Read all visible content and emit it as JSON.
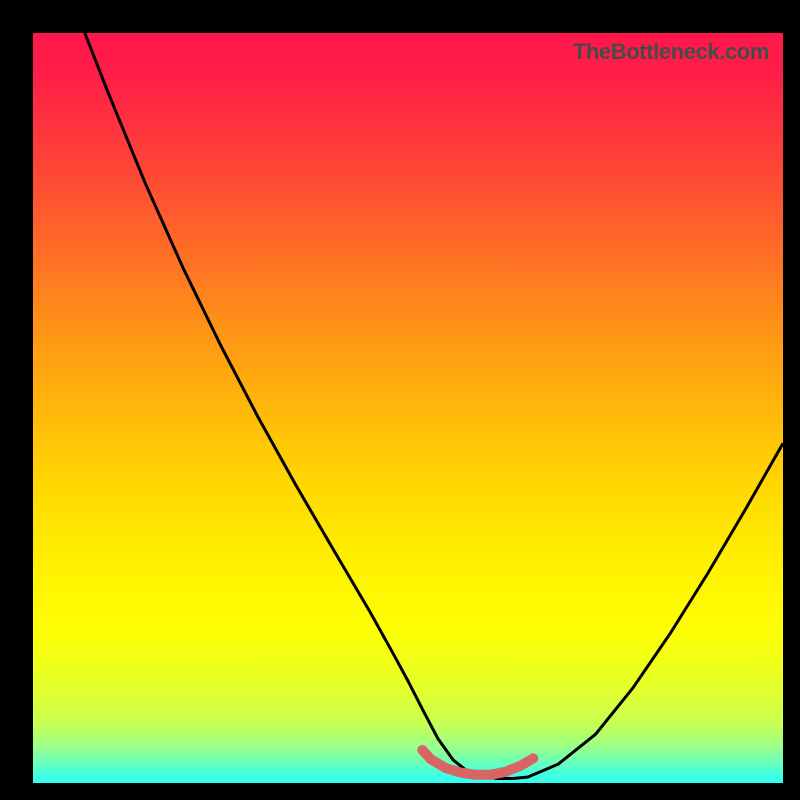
{
  "watermark": "TheBottleneck.com",
  "colors": {
    "background": "#000000",
    "curve_stroke": "#000000",
    "accent_stroke": "#d86464",
    "gradient_top": "#ff1649",
    "gradient_bottom": "#2dfff3"
  },
  "chart_data": {
    "type": "line",
    "title": "",
    "xlabel": "",
    "ylabel": "",
    "xlim": [
      0,
      100
    ],
    "ylim": [
      0,
      100
    ],
    "grid": false,
    "legend": false,
    "annotations": [
      "TheBottleneck.com"
    ],
    "series": [
      {
        "name": "main-curve",
        "color": "#000000",
        "x": [
          6.9,
          10,
          15,
          20,
          25,
          30,
          35,
          40,
          45,
          48,
          50,
          52,
          54,
          56,
          58,
          60,
          62,
          64,
          66,
          70,
          75,
          80,
          85,
          90,
          95,
          100
        ],
        "y": [
          100,
          92.1,
          79.9,
          68.7,
          58.4,
          48.8,
          39.8,
          31.2,
          22.7,
          17.3,
          13.6,
          9.7,
          5.9,
          3.1,
          1.5,
          0.8,
          0.6,
          0.6,
          0.8,
          2.5,
          6.5,
          12.7,
          20.0,
          28.0,
          36.5,
          45.3
        ]
      },
      {
        "name": "bottom-accent",
        "color": "#d86464",
        "x": [
          51.9,
          53,
          55,
          57,
          59,
          61,
          63,
          65,
          66.7
        ],
        "y": [
          4.4,
          3.2,
          2.0,
          1.4,
          1.1,
          1.1,
          1.5,
          2.3,
          3.3
        ]
      }
    ]
  }
}
